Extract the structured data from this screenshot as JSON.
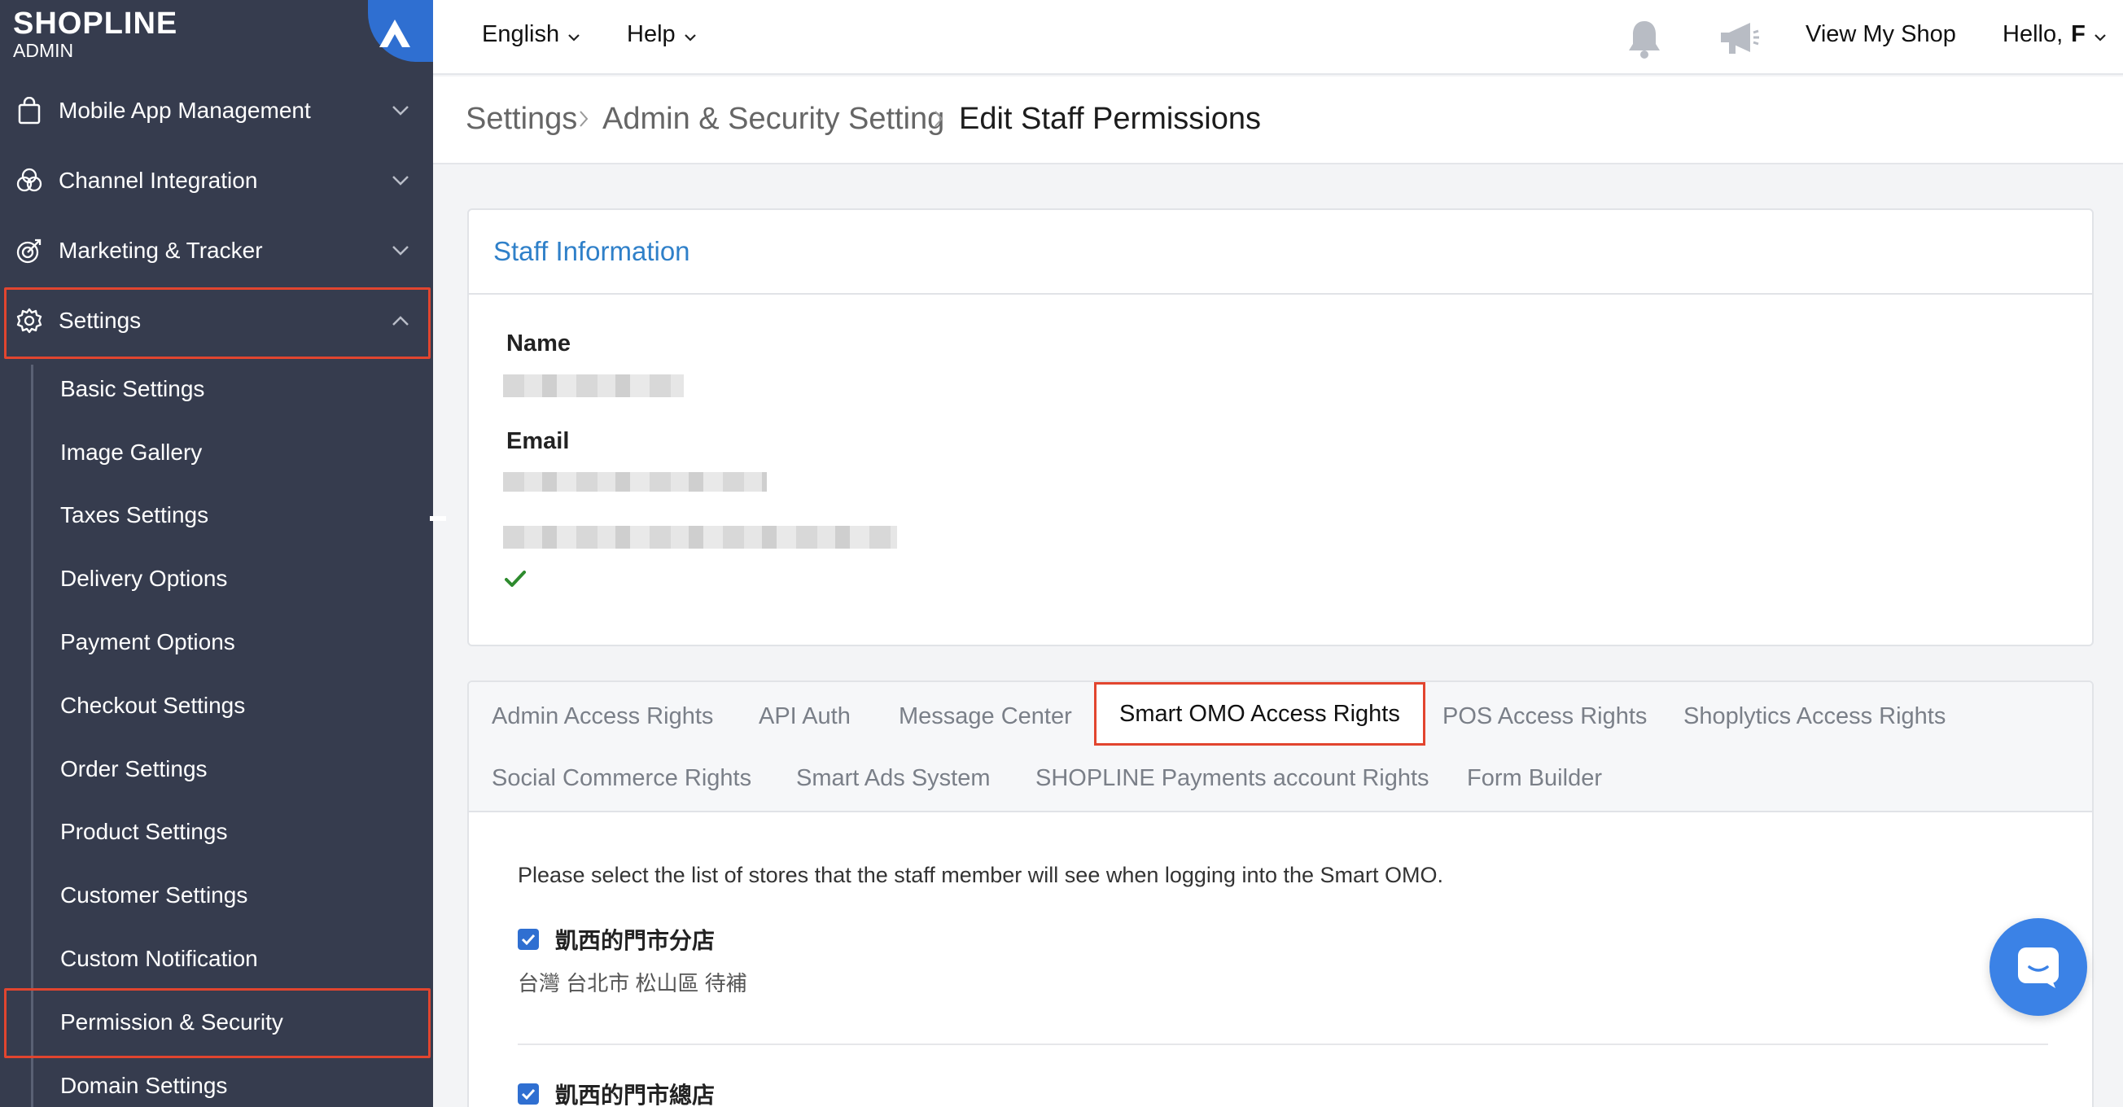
{
  "brand": {
    "logo": "SHOPLINE",
    "sub": "ADMIN",
    "accent_color": "#2f6fd1",
    "sidebar_color": "#363c4e",
    "highlight_color": "#e2452f"
  },
  "sidebar": {
    "sections": [
      {
        "label": "Mobile App Management",
        "icon": "shopping-bag-icon",
        "expanded": false
      },
      {
        "label": "Channel Integration",
        "icon": "channels-icon",
        "expanded": false
      },
      {
        "label": "Marketing & Tracker",
        "icon": "target-icon",
        "expanded": false
      },
      {
        "label": "Settings",
        "icon": "gear-icon",
        "expanded": true
      }
    ],
    "settings_items": [
      {
        "label": "Basic Settings"
      },
      {
        "label": "Image Gallery"
      },
      {
        "label": "Taxes Settings"
      },
      {
        "label": "Delivery Options"
      },
      {
        "label": "Payment Options"
      },
      {
        "label": "Checkout Settings"
      },
      {
        "label": "Order Settings"
      },
      {
        "label": "Product Settings"
      },
      {
        "label": "Customer Settings"
      },
      {
        "label": "Custom Notification"
      },
      {
        "label": "Permission & Security"
      },
      {
        "label": "Domain Settings"
      }
    ]
  },
  "topbar": {
    "language": "English",
    "help": "Help",
    "view_shop": "View My Shop",
    "greeting": "Hello,",
    "greeting_name": "F",
    "icons": [
      "bell-icon",
      "megaphone-icon"
    ]
  },
  "breadcrumb": {
    "items": [
      "Settings",
      "Admin & Security Setting"
    ],
    "current": "Edit Staff Permissions"
  },
  "staff_info": {
    "title": "Staff Information",
    "name_label": "Name",
    "email_label": "Email"
  },
  "tabs": {
    "row1": [
      "Admin Access Rights",
      "API Auth",
      "Message Center",
      "Smart OMO Access Rights",
      "POS Access Rights",
      "Shoplytics Access Rights"
    ],
    "row2": [
      "Social Commerce Rights",
      "Smart Ads System",
      "SHOPLINE Payments account Rights",
      "Form Builder"
    ],
    "active": "Smart OMO Access Rights"
  },
  "omo": {
    "description": "Please select the list of stores that the staff member will see when logging into the Smart OMO.",
    "stores": [
      {
        "name": "凱西的門市分店",
        "address": "台灣 台北市 松山區 待補",
        "checked": true
      },
      {
        "name": "凱西的門市總店",
        "checked": true
      }
    ]
  }
}
